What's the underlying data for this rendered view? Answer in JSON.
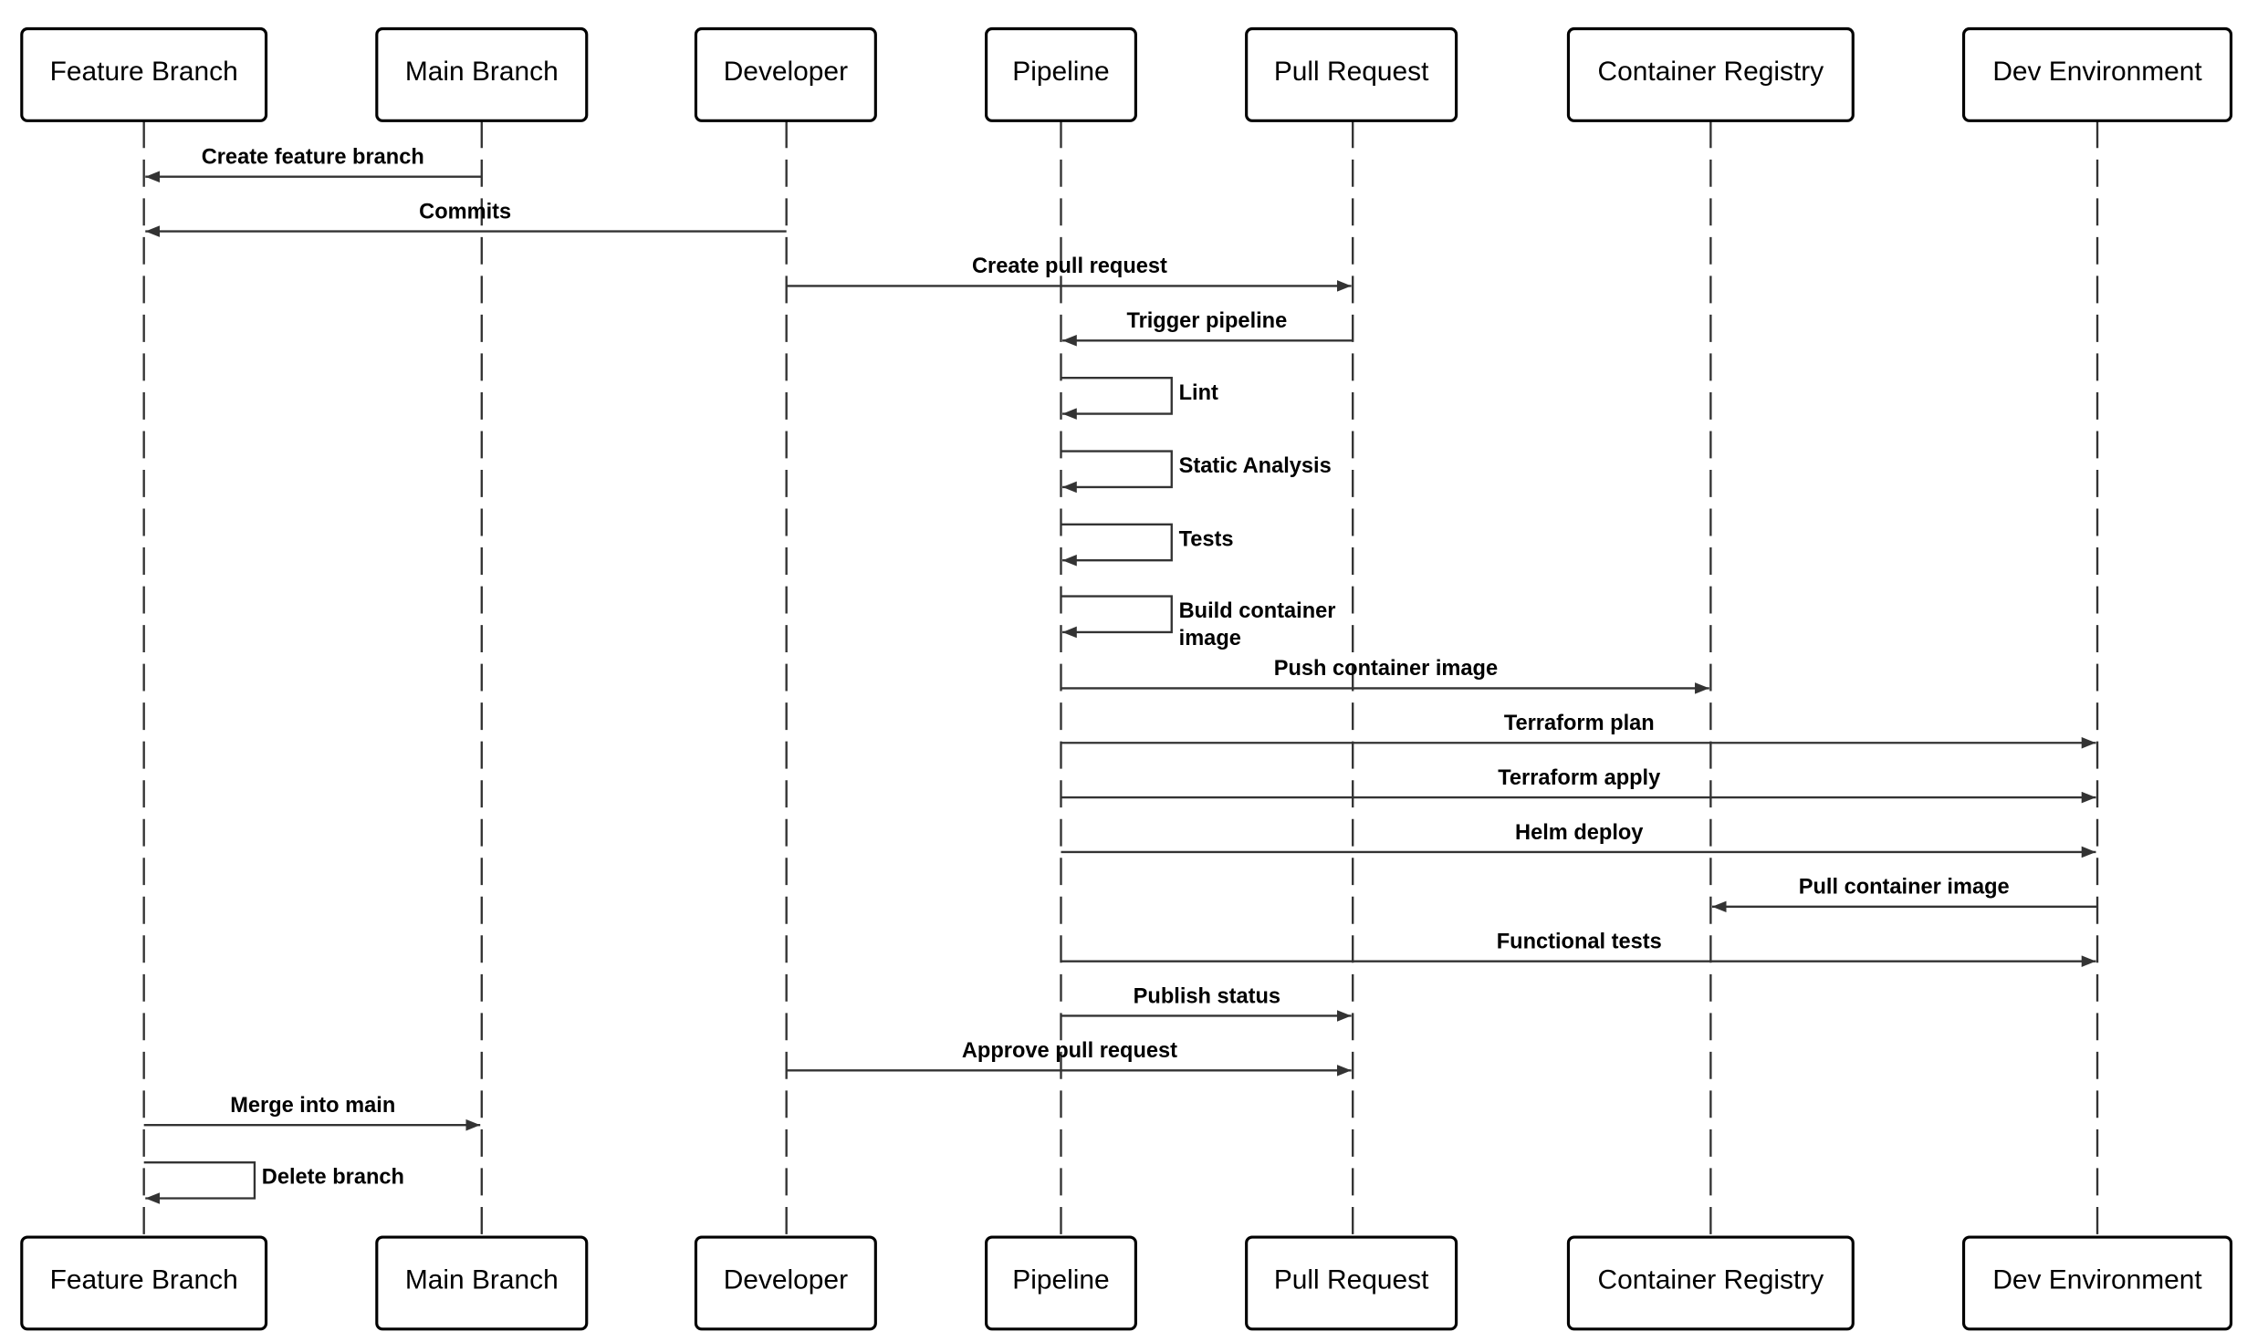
{
  "participants": [
    {
      "id": "feature",
      "label": "Feature Branch"
    },
    {
      "id": "main",
      "label": "Main Branch"
    },
    {
      "id": "developer",
      "label": "Developer"
    },
    {
      "id": "pipeline",
      "label": "Pipeline"
    },
    {
      "id": "pr",
      "label": "Pull Request"
    },
    {
      "id": "registry",
      "label": "Container Registry"
    },
    {
      "id": "dev",
      "label": "Dev Environment"
    }
  ],
  "messages": [
    {
      "from": "main",
      "to": "feature",
      "label": "Create feature branch"
    },
    {
      "from": "developer",
      "to": "feature",
      "label": "Commits"
    },
    {
      "from": "developer",
      "to": "pr",
      "label": "Create pull request"
    },
    {
      "from": "pr",
      "to": "pipeline",
      "label": "Trigger pipeline"
    },
    {
      "from": "pipeline",
      "to": "pipeline",
      "label": "Lint"
    },
    {
      "from": "pipeline",
      "to": "pipeline",
      "label": "Static Analysis"
    },
    {
      "from": "pipeline",
      "to": "pipeline",
      "label": "Tests"
    },
    {
      "from": "pipeline",
      "to": "pipeline",
      "label": [
        "Build container",
        "image"
      ]
    },
    {
      "from": "pipeline",
      "to": "registry",
      "label": "Push container image"
    },
    {
      "from": "pipeline",
      "to": "dev",
      "label": "Terraform plan"
    },
    {
      "from": "pipeline",
      "to": "dev",
      "label": "Terraform apply"
    },
    {
      "from": "pipeline",
      "to": "dev",
      "label": "Helm deploy"
    },
    {
      "from": "dev",
      "to": "registry",
      "label": "Pull container image"
    },
    {
      "from": "pipeline",
      "to": "dev",
      "label": "Functional tests"
    },
    {
      "from": "pipeline",
      "to": "pr",
      "label": "Publish status"
    },
    {
      "from": "developer",
      "to": "pr",
      "label": "Approve pull request"
    },
    {
      "from": "feature",
      "to": "main",
      "label": "Merge into main"
    },
    {
      "from": "feature",
      "to": "feature",
      "label": "Delete branch"
    }
  ],
  "colors": {
    "line": "#333333",
    "box_border": "#000000"
  }
}
